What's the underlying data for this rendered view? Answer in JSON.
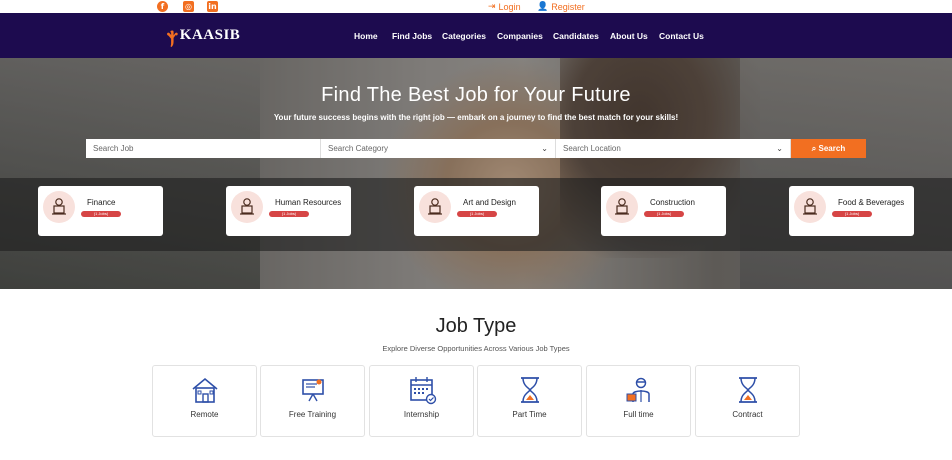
{
  "topbar": {
    "social": [
      "facebook-icon",
      "instagram-icon",
      "linkedin-icon"
    ],
    "login": "Login",
    "register": "Register"
  },
  "brand": {
    "name": "KAASIB"
  },
  "nav": [
    "Home",
    "Find Jobs",
    "Categories",
    "Companies",
    "Candidates",
    "About Us",
    "Contact Us"
  ],
  "hero": {
    "title": "Find The Best Job for Your Future",
    "subtitle": "Your future success begins with the right job — embark on a journey to find the best match for your skills!"
  },
  "search": {
    "job_placeholder": "Search Job",
    "category_placeholder": "Search Category",
    "location_placeholder": "Search Location",
    "button": "Search"
  },
  "categories": [
    {
      "title": "Finance",
      "badge": "(1 Jobs)"
    },
    {
      "title": "Human Resources",
      "badge": "(1 Jobs)"
    },
    {
      "title": "Art and Design",
      "badge": "(1 Jobs)"
    },
    {
      "title": "Construction",
      "badge": "(1 Jobs)"
    },
    {
      "title": "Food & Beverages",
      "badge": "(1 Jobs)"
    }
  ],
  "job_type": {
    "title": "Job Type",
    "subtitle": "Explore Diverse Opportunities Across Various Job Types",
    "items": [
      {
        "label": "Remote",
        "icon": "house-icon"
      },
      {
        "label": "Free Training",
        "icon": "training-board-icon"
      },
      {
        "label": "Internship",
        "icon": "calendar-icon"
      },
      {
        "label": "Part Time",
        "icon": "hourglass-icon"
      },
      {
        "label": "Full time",
        "icon": "worker-icon"
      },
      {
        "label": "Contract",
        "icon": "hourglass-icon"
      }
    ]
  },
  "colors": {
    "accent": "#f26f21",
    "navbar": "#1d0b4f",
    "badge": "#d64545",
    "icon_blue": "#2e4fa8"
  }
}
